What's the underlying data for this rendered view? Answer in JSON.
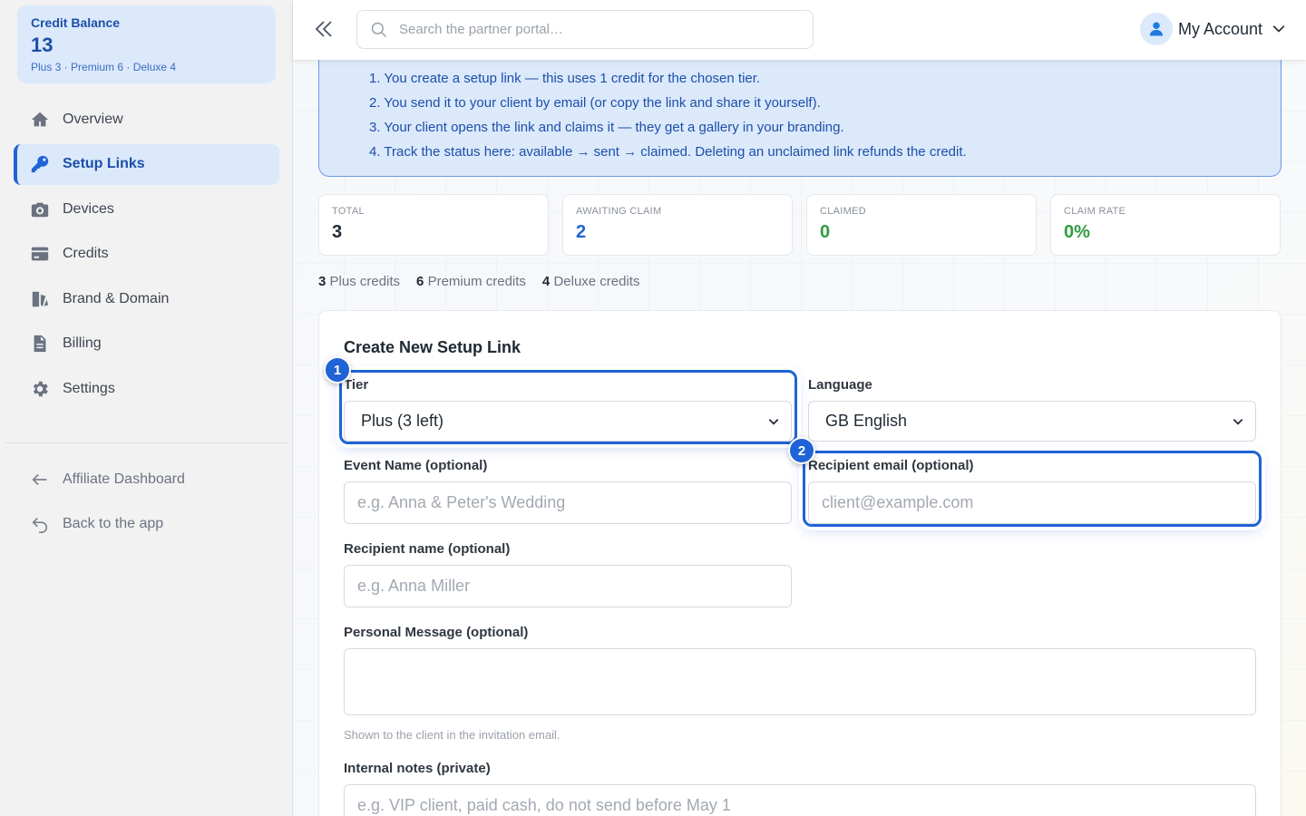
{
  "sidebar": {
    "credit_balance": {
      "label": "Credit Balance",
      "value": "13",
      "breakdown": "Plus 3 · Premium 6 · Deluxe 4"
    },
    "items": [
      {
        "label": "Overview",
        "icon": "home-icon"
      },
      {
        "label": "Setup Links",
        "icon": "key-icon",
        "active": true
      },
      {
        "label": "Devices",
        "icon": "camera-icon"
      },
      {
        "label": "Credits",
        "icon": "credit-card-icon"
      },
      {
        "label": "Brand & Domain",
        "icon": "palette-icon"
      },
      {
        "label": "Billing",
        "icon": "document-icon"
      },
      {
        "label": "Settings",
        "icon": "gear-icon"
      }
    ],
    "footer_items": [
      {
        "label": "Affiliate Dashboard",
        "icon": "arrow-left-icon"
      },
      {
        "label": "Back to the app",
        "icon": "undo-arrow-icon"
      }
    ]
  },
  "header": {
    "search_placeholder": "Search the partner portal…",
    "account_label": "My Account"
  },
  "steps": [
    "1. You create a setup link — this uses 1 credit for the chosen tier.",
    "2. You send it to your client by email (or copy the link and share it yourself).",
    "3. Your client opens the link and claims it — they get a gallery in your branding.",
    "4. Track the status here: available → sent → claimed. Deleting an unclaimed link refunds the credit."
  ],
  "stats": [
    {
      "label": "TOTAL",
      "value": "3",
      "color": "#1f2933"
    },
    {
      "label": "AWAITING CLAIM",
      "value": "2",
      "color": "#1f63d6"
    },
    {
      "label": "CLAIMED",
      "value": "0",
      "color": "#2e9d3f"
    },
    {
      "label": "CLAIM RATE",
      "value": "0%",
      "color": "#2e9d3f"
    }
  ],
  "credits": [
    {
      "count": "3",
      "label": "Plus credits"
    },
    {
      "count": "6",
      "label": "Premium credits"
    },
    {
      "count": "4",
      "label": "Deluxe credits"
    }
  ],
  "form": {
    "title": "Create New Setup Link",
    "tier_label": "Tier",
    "tier_value": "Plus (3 left)",
    "language_label": "Language",
    "language_value": "GB English",
    "event_label": "Event Name (optional)",
    "event_placeholder": "e.g. Anna & Peter's Wedding",
    "email_label": "Recipient email (optional)",
    "email_placeholder": "client@example.com",
    "name_label": "Recipient name (optional)",
    "name_placeholder": "e.g. Anna Miller",
    "message_label": "Personal Message (optional)",
    "message_hint": "Shown to the client in the invitation email.",
    "notes_label": "Internal notes (private)",
    "notes_placeholder": "e.g. VIP client, paid cash, do not send before May 1"
  },
  "badges": [
    "1",
    "2"
  ],
  "colors": {
    "accent": "#1f63d6",
    "accent_light": "#dbe9fb",
    "success": "#2e9d3f"
  }
}
